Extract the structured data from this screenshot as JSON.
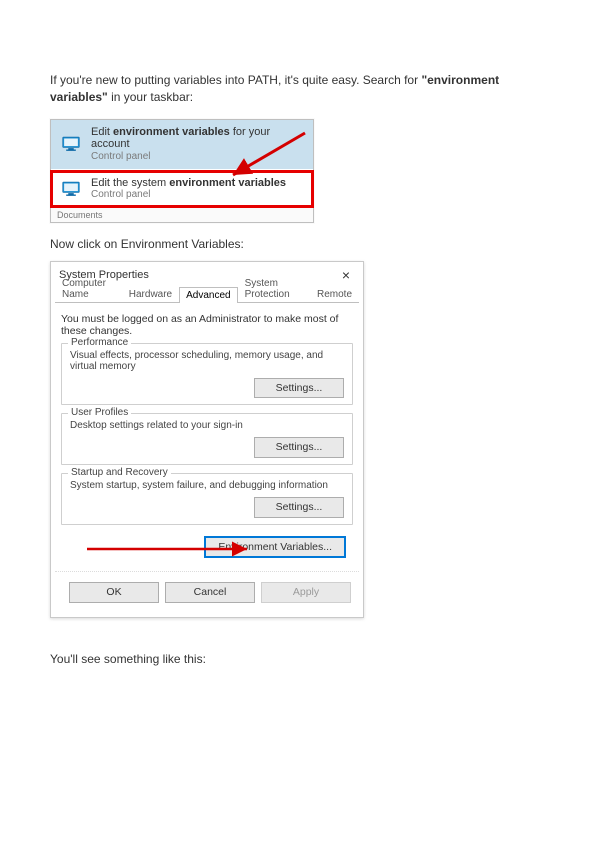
{
  "intro": {
    "before": "If you're new to putting variables into PATH, it's quite easy. Search for ",
    "bold": "\"environment variables\"",
    "after": " in your taskbar:"
  },
  "search": {
    "results": [
      {
        "title_pre": "Edit ",
        "title_match": "environment variables",
        "title_post": " for your account",
        "subtitle": "Control panel"
      },
      {
        "title_pre": "Edit the system ",
        "title_match": "environment variables",
        "title_post": "",
        "subtitle": "Control panel"
      }
    ],
    "footer": "Documents"
  },
  "step2": "Now click on Environment Variables:",
  "dlg": {
    "title": "System Properties",
    "close_glyph": "×",
    "tabs": [
      "Computer Name",
      "Hardware",
      "Advanced",
      "System Protection",
      "Remote"
    ],
    "active_tab": 2,
    "hint": "You must be logged on as an Administrator to make most of these changes.",
    "groups": [
      {
        "legend": "Performance",
        "desc": "Visual effects, processor scheduling, memory usage, and virtual memory",
        "button": "Settings..."
      },
      {
        "legend": "User Profiles",
        "desc": "Desktop settings related to your sign-in",
        "button": "Settings..."
      },
      {
        "legend": "Startup and Recovery",
        "desc": "System startup, system failure, and debugging information",
        "button": "Settings..."
      }
    ],
    "env_button": "Environment Variables...",
    "footer": {
      "ok": "OK",
      "cancel": "Cancel",
      "apply": "Apply"
    }
  },
  "step3": "You'll see something like this:"
}
